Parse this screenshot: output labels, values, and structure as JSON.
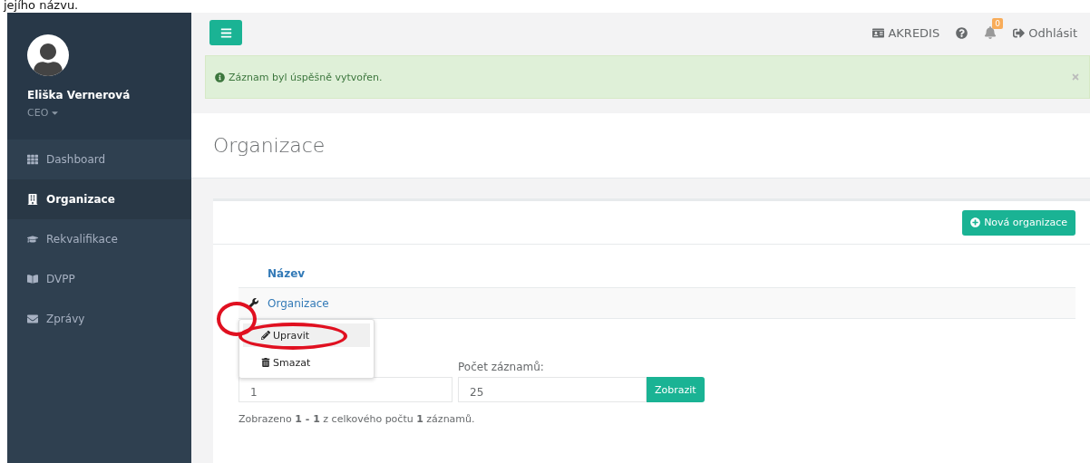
{
  "caption": "jejího názvu.",
  "user": {
    "name": "Eliška Vernerová",
    "role": "CEO"
  },
  "sidebar": {
    "items": [
      {
        "label": "Dashboard",
        "selected": false
      },
      {
        "label": "Organizace",
        "selected": true
      },
      {
        "label": "Rekvalifikace",
        "selected": false
      },
      {
        "label": "DVPP",
        "selected": false
      },
      {
        "label": "Zprávy",
        "selected": false
      }
    ]
  },
  "topbar": {
    "brand": "AKREDIS",
    "notifications": "0",
    "logout": "Odhlásit"
  },
  "alert": {
    "text": "Záznam byl úspěšně vytvořen."
  },
  "page_title": "Organizace",
  "new_button": "Nová organizace",
  "table": {
    "columns": [
      "Název"
    ],
    "rows": [
      {
        "name": "Organizace"
      }
    ]
  },
  "row_menu": {
    "items": [
      {
        "label": "Upravit",
        "selected": true
      },
      {
        "label": "Smazat",
        "selected": false
      }
    ]
  },
  "annotations": [
    {
      "kind": "circle"
    },
    {
      "kind": "circle"
    }
  ],
  "pagination": {
    "page_value": "1",
    "per_page_label": "Počet záznamů:",
    "per_page_value": "25",
    "show_button": "Zobrazit",
    "summary": "Zobrazeno **1 - 1** z celkového počtu **1** záznamů."
  }
}
